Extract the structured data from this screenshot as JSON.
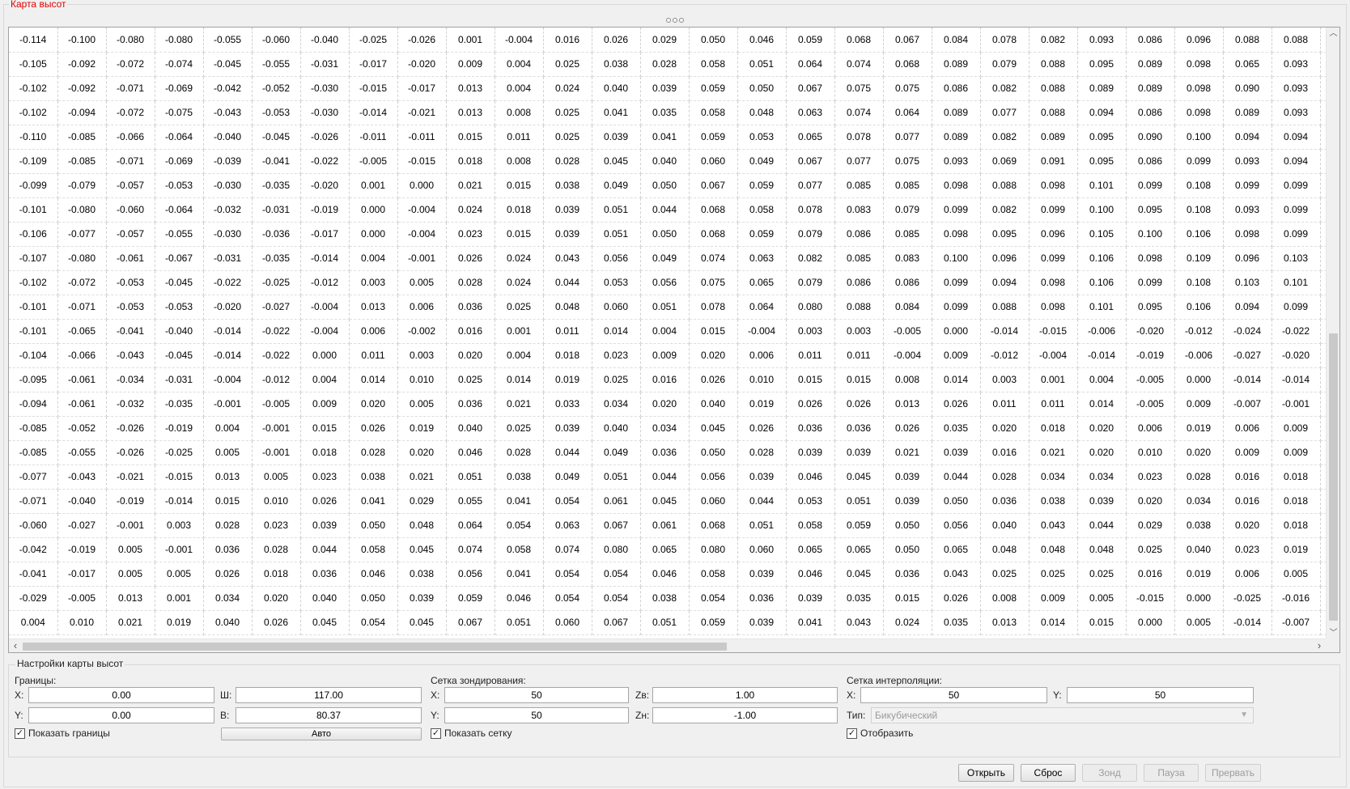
{
  "panel": {
    "title": "Карта высот"
  },
  "heightmap": {
    "rows": [
      [
        "-0.114",
        "-0.100",
        "-0.080",
        "-0.080",
        "-0.055",
        "-0.060",
        "-0.040",
        "-0.025",
        "-0.026",
        "0.001",
        "-0.004",
        "0.016",
        "0.026",
        "0.029",
        "0.050",
        "0.046",
        "0.059",
        "0.068",
        "0.067",
        "0.084",
        "0.078",
        "0.082",
        "0.093",
        "0.086",
        "0.096",
        "0.088",
        "0.088"
      ],
      [
        "-0.105",
        "-0.092",
        "-0.072",
        "-0.074",
        "-0.045",
        "-0.055",
        "-0.031",
        "-0.017",
        "-0.020",
        "0.009",
        "0.004",
        "0.025",
        "0.038",
        "0.028",
        "0.058",
        "0.051",
        "0.064",
        "0.074",
        "0.068",
        "0.089",
        "0.079",
        "0.088",
        "0.095",
        "0.089",
        "0.098",
        "0.065",
        "0.093"
      ],
      [
        "-0.102",
        "-0.092",
        "-0.071",
        "-0.069",
        "-0.042",
        "-0.052",
        "-0.030",
        "-0.015",
        "-0.017",
        "0.013",
        "0.004",
        "0.024",
        "0.040",
        "0.039",
        "0.059",
        "0.050",
        "0.067",
        "0.075",
        "0.075",
        "0.086",
        "0.082",
        "0.088",
        "0.089",
        "0.089",
        "0.098",
        "0.090",
        "0.093"
      ],
      [
        "-0.102",
        "-0.094",
        "-0.072",
        "-0.075",
        "-0.043",
        "-0.053",
        "-0.030",
        "-0.014",
        "-0.021",
        "0.013",
        "0.008",
        "0.025",
        "0.041",
        "0.035",
        "0.058",
        "0.048",
        "0.063",
        "0.074",
        "0.064",
        "0.089",
        "0.077",
        "0.088",
        "0.094",
        "0.086",
        "0.098",
        "0.089",
        "0.093"
      ],
      [
        "-0.110",
        "-0.085",
        "-0.066",
        "-0.064",
        "-0.040",
        "-0.045",
        "-0.026",
        "-0.011",
        "-0.011",
        "0.015",
        "0.011",
        "0.025",
        "0.039",
        "0.041",
        "0.059",
        "0.053",
        "0.065",
        "0.078",
        "0.077",
        "0.089",
        "0.082",
        "0.089",
        "0.095",
        "0.090",
        "0.100",
        "0.094",
        "0.094"
      ],
      [
        "-0.109",
        "-0.085",
        "-0.071",
        "-0.069",
        "-0.039",
        "-0.041",
        "-0.022",
        "-0.005",
        "-0.015",
        "0.018",
        "0.008",
        "0.028",
        "0.045",
        "0.040",
        "0.060",
        "0.049",
        "0.067",
        "0.077",
        "0.075",
        "0.093",
        "0.069",
        "0.091",
        "0.095",
        "0.086",
        "0.099",
        "0.093",
        "0.094"
      ],
      [
        "-0.099",
        "-0.079",
        "-0.057",
        "-0.053",
        "-0.030",
        "-0.035",
        "-0.020",
        "0.001",
        "0.000",
        "0.021",
        "0.015",
        "0.038",
        "0.049",
        "0.050",
        "0.067",
        "0.059",
        "0.077",
        "0.085",
        "0.085",
        "0.098",
        "0.088",
        "0.098",
        "0.101",
        "0.099",
        "0.108",
        "0.099",
        "0.099"
      ],
      [
        "-0.101",
        "-0.080",
        "-0.060",
        "-0.064",
        "-0.032",
        "-0.031",
        "-0.019",
        "0.000",
        "-0.004",
        "0.024",
        "0.018",
        "0.039",
        "0.051",
        "0.044",
        "0.068",
        "0.058",
        "0.078",
        "0.083",
        "0.079",
        "0.099",
        "0.082",
        "0.099",
        "0.100",
        "0.095",
        "0.108",
        "0.093",
        "0.099"
      ],
      [
        "-0.106",
        "-0.077",
        "-0.057",
        "-0.055",
        "-0.030",
        "-0.036",
        "-0.017",
        "0.000",
        "-0.004",
        "0.023",
        "0.015",
        "0.039",
        "0.051",
        "0.050",
        "0.068",
        "0.059",
        "0.079",
        "0.086",
        "0.085",
        "0.098",
        "0.095",
        "0.096",
        "0.105",
        "0.100",
        "0.106",
        "0.098",
        "0.099"
      ],
      [
        "-0.107",
        "-0.080",
        "-0.061",
        "-0.067",
        "-0.031",
        "-0.035",
        "-0.014",
        "0.004",
        "-0.001",
        "0.026",
        "0.024",
        "0.043",
        "0.056",
        "0.049",
        "0.074",
        "0.063",
        "0.082",
        "0.085",
        "0.083",
        "0.100",
        "0.096",
        "0.099",
        "0.106",
        "0.098",
        "0.109",
        "0.096",
        "0.103"
      ],
      [
        "-0.102",
        "-0.072",
        "-0.053",
        "-0.045",
        "-0.022",
        "-0.025",
        "-0.012",
        "0.003",
        "0.005",
        "0.028",
        "0.024",
        "0.044",
        "0.053",
        "0.056",
        "0.075",
        "0.065",
        "0.079",
        "0.086",
        "0.086",
        "0.099",
        "0.094",
        "0.098",
        "0.106",
        "0.099",
        "0.108",
        "0.103",
        "0.101"
      ],
      [
        "-0.101",
        "-0.071",
        "-0.053",
        "-0.053",
        "-0.020",
        "-0.027",
        "-0.004",
        "0.013",
        "0.006",
        "0.036",
        "0.025",
        "0.048",
        "0.060",
        "0.051",
        "0.078",
        "0.064",
        "0.080",
        "0.088",
        "0.084",
        "0.099",
        "0.088",
        "0.098",
        "0.101",
        "0.095",
        "0.106",
        "0.094",
        "0.099"
      ],
      [
        "-0.101",
        "-0.065",
        "-0.041",
        "-0.040",
        "-0.014",
        "-0.022",
        "-0.004",
        "0.006",
        "-0.002",
        "0.016",
        "0.001",
        "0.011",
        "0.014",
        "0.004",
        "0.015",
        "-0.004",
        "0.003",
        "0.003",
        "-0.005",
        "0.000",
        "-0.014",
        "-0.015",
        "-0.006",
        "-0.020",
        "-0.012",
        "-0.024",
        "-0.022"
      ],
      [
        "-0.104",
        "-0.066",
        "-0.043",
        "-0.045",
        "-0.014",
        "-0.022",
        "0.000",
        "0.011",
        "0.003",
        "0.020",
        "0.004",
        "0.018",
        "0.023",
        "0.009",
        "0.020",
        "0.006",
        "0.011",
        "0.011",
        "-0.004",
        "0.009",
        "-0.012",
        "-0.004",
        "-0.014",
        "-0.019",
        "-0.006",
        "-0.027",
        "-0.020"
      ],
      [
        "-0.095",
        "-0.061",
        "-0.034",
        "-0.031",
        "-0.004",
        "-0.012",
        "0.004",
        "0.014",
        "0.010",
        "0.025",
        "0.014",
        "0.019",
        "0.025",
        "0.016",
        "0.026",
        "0.010",
        "0.015",
        "0.015",
        "0.008",
        "0.014",
        "0.003",
        "0.001",
        "0.004",
        "-0.005",
        "0.000",
        "-0.014",
        "-0.014"
      ],
      [
        "-0.094",
        "-0.061",
        "-0.032",
        "-0.035",
        "-0.001",
        "-0.005",
        "0.009",
        "0.020",
        "0.005",
        "0.036",
        "0.021",
        "0.033",
        "0.034",
        "0.020",
        "0.040",
        "0.019",
        "0.026",
        "0.026",
        "0.013",
        "0.026",
        "0.011",
        "0.011",
        "0.014",
        "-0.005",
        "0.009",
        "-0.007",
        "-0.001"
      ],
      [
        "-0.085",
        "-0.052",
        "-0.026",
        "-0.019",
        "0.004",
        "-0.001",
        "0.015",
        "0.026",
        "0.019",
        "0.040",
        "0.025",
        "0.039",
        "0.040",
        "0.034",
        "0.045",
        "0.026",
        "0.036",
        "0.036",
        "0.026",
        "0.035",
        "0.020",
        "0.018",
        "0.020",
        "0.006",
        "0.019",
        "0.006",
        "0.009"
      ],
      [
        "-0.085",
        "-0.055",
        "-0.026",
        "-0.025",
        "0.005",
        "-0.001",
        "0.018",
        "0.028",
        "0.020",
        "0.046",
        "0.028",
        "0.044",
        "0.049",
        "0.036",
        "0.050",
        "0.028",
        "0.039",
        "0.039",
        "0.021",
        "0.039",
        "0.016",
        "0.021",
        "0.020",
        "0.010",
        "0.020",
        "0.009",
        "0.009"
      ],
      [
        "-0.077",
        "-0.043",
        "-0.021",
        "-0.015",
        "0.013",
        "0.005",
        "0.023",
        "0.038",
        "0.021",
        "0.051",
        "0.038",
        "0.049",
        "0.051",
        "0.044",
        "0.056",
        "0.039",
        "0.046",
        "0.045",
        "0.039",
        "0.044",
        "0.028",
        "0.034",
        "0.034",
        "0.023",
        "0.028",
        "0.016",
        "0.018"
      ],
      [
        "-0.071",
        "-0.040",
        "-0.019",
        "-0.014",
        "0.015",
        "0.010",
        "0.026",
        "0.041",
        "0.029",
        "0.055",
        "0.041",
        "0.054",
        "0.061",
        "0.045",
        "0.060",
        "0.044",
        "0.053",
        "0.051",
        "0.039",
        "0.050",
        "0.036",
        "0.038",
        "0.039",
        "0.020",
        "0.034",
        "0.016",
        "0.018"
      ],
      [
        "-0.060",
        "-0.027",
        "-0.001",
        "0.003",
        "0.028",
        "0.023",
        "0.039",
        "0.050",
        "0.048",
        "0.064",
        "0.054",
        "0.063",
        "0.067",
        "0.061",
        "0.068",
        "0.051",
        "0.058",
        "0.059",
        "0.050",
        "0.056",
        "0.040",
        "0.043",
        "0.044",
        "0.029",
        "0.038",
        "0.020",
        "0.018"
      ],
      [
        "-0.042",
        "-0.019",
        "0.005",
        "-0.001",
        "0.036",
        "0.028",
        "0.044",
        "0.058",
        "0.045",
        "0.074",
        "0.058",
        "0.074",
        "0.080",
        "0.065",
        "0.080",
        "0.060",
        "0.065",
        "0.065",
        "0.050",
        "0.065",
        "0.048",
        "0.048",
        "0.048",
        "0.025",
        "0.040",
        "0.023",
        "0.019"
      ],
      [
        "-0.041",
        "-0.017",
        "0.005",
        "0.005",
        "0.026",
        "0.018",
        "0.036",
        "0.046",
        "0.038",
        "0.056",
        "0.041",
        "0.054",
        "0.054",
        "0.046",
        "0.058",
        "0.039",
        "0.046",
        "0.045",
        "0.036",
        "0.043",
        "0.025",
        "0.025",
        "0.025",
        "0.016",
        "0.019",
        "0.006",
        "0.005"
      ],
      [
        "-0.029",
        "-0.005",
        "0.013",
        "0.001",
        "0.034",
        "0.020",
        "0.040",
        "0.050",
        "0.039",
        "0.059",
        "0.046",
        "0.054",
        "0.054",
        "0.038",
        "0.054",
        "0.036",
        "0.039",
        "0.035",
        "0.015",
        "0.026",
        "0.008",
        "0.009",
        "0.005",
        "-0.015",
        "0.000",
        "-0.025",
        "-0.016"
      ],
      [
        "0.004",
        "0.010",
        "0.021",
        "0.019",
        "0.040",
        "0.026",
        "0.045",
        "0.054",
        "0.045",
        "0.067",
        "0.051",
        "0.060",
        "0.067",
        "0.051",
        "0.059",
        "0.039",
        "0.041",
        "0.043",
        "0.024",
        "0.035",
        "0.013",
        "0.014",
        "0.015",
        "0.000",
        "0.005",
        "-0.014",
        "-0.007"
      ]
    ]
  },
  "settings": {
    "title": "Настройки карты высот",
    "bounds": {
      "title": "Границы:",
      "x_label": "X:",
      "x_value": "0.00",
      "y_label": "Y:",
      "y_value": "0.00",
      "w_label": "Ш:",
      "w_value": "117.00",
      "h_label": "В:",
      "h_value": "80.37",
      "show_label": "Показать границы",
      "show_checked": true,
      "auto_label": "Авто"
    },
    "probe": {
      "title": "Сетка зондирования:",
      "x_label": "X:",
      "x_value": "50",
      "y_label": "Y:",
      "y_value": "50",
      "zt_label": "Zв:",
      "zt_value": "1.00",
      "zb_label": "Zн:",
      "zb_value": "-1.00",
      "show_label": "Показать сетку",
      "show_checked": true
    },
    "interp": {
      "title": "Сетка интерполяции:",
      "x_label": "X:",
      "x_value": "50",
      "y_label": "Y:",
      "y_value": "50",
      "type_label": "Тип:",
      "type_value": "Бикубический",
      "show_label": "Отобразить",
      "show_checked": true
    }
  },
  "buttons": {
    "open": "Открыть",
    "reset": "Сброс",
    "probe": "Зонд",
    "pause": "Пауза",
    "abort": "Прервать"
  },
  "checkmark": "✓"
}
